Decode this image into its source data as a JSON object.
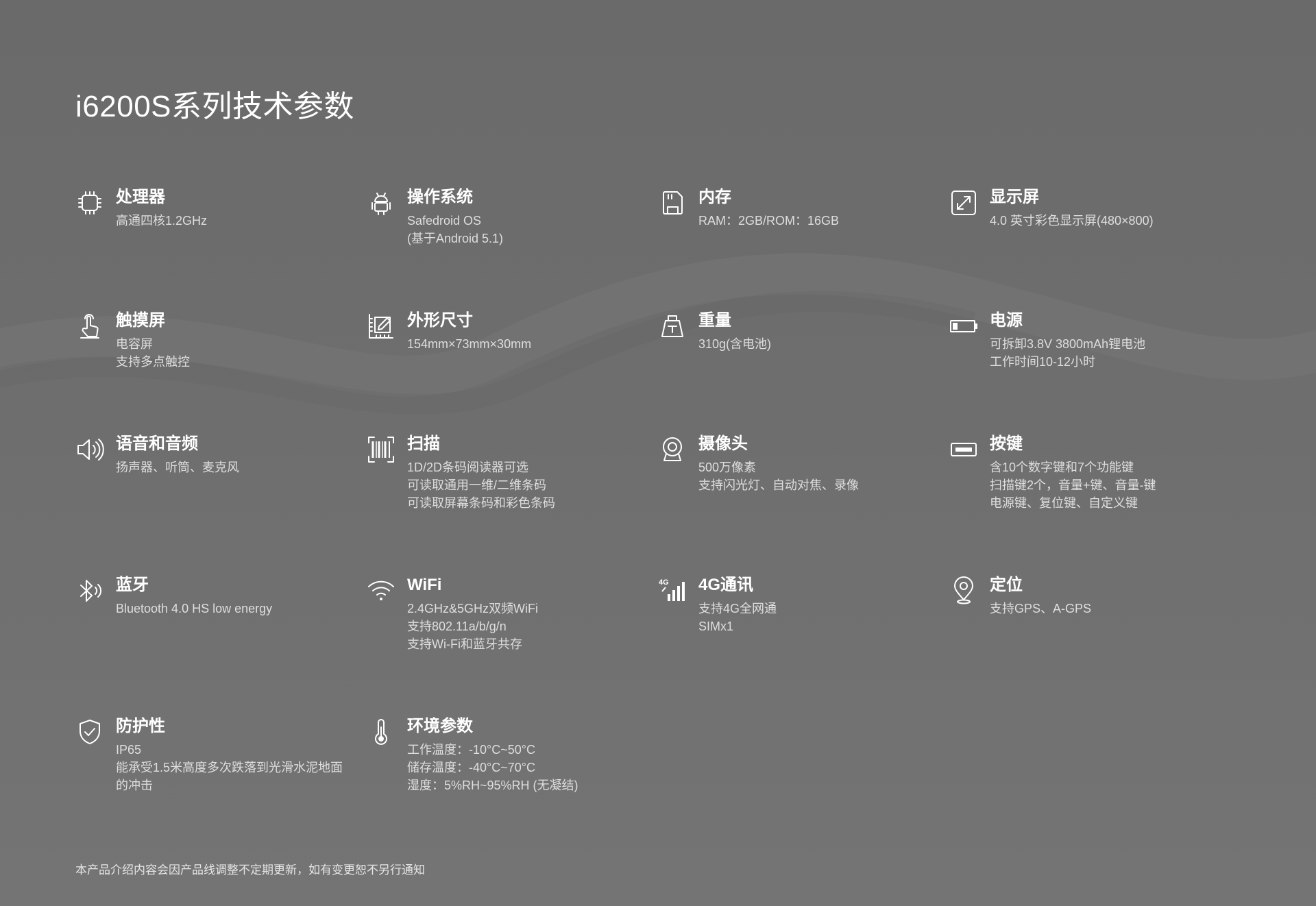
{
  "page": {
    "title": "i6200S系列技术参数",
    "footnote": "本产品介绍内容会因产品线调整不定期更新，如有变更恕不另行通知"
  },
  "colors": {
    "background": "#6e6e6e",
    "text": "#ffffff",
    "subtext": "#dedede"
  },
  "specs": [
    {
      "icon": "cpu-icon",
      "title": "处理器",
      "lines": [
        "高通四核1.2GHz"
      ]
    },
    {
      "icon": "android-icon",
      "title": "操作系统",
      "lines": [
        "Safedroid OS",
        "(基于Android 5.1)"
      ]
    },
    {
      "icon": "sd-card-icon",
      "title": "内存",
      "lines": [
        "RAM：2GB/ROM：16GB"
      ]
    },
    {
      "icon": "expand-icon",
      "title": "显示屏",
      "lines": [
        "4.0 英寸彩色显示屏(480×800)"
      ]
    },
    {
      "icon": "touch-icon",
      "title": "触摸屏",
      "lines": [
        "电容屏",
        "支持多点触控"
      ]
    },
    {
      "icon": "ruler-pencil-icon",
      "title": "外形尺寸",
      "lines": [
        "154mm×73mm×30mm"
      ]
    },
    {
      "icon": "weight-icon",
      "title": "重量",
      "lines": [
        "310g(含电池)"
      ]
    },
    {
      "icon": "battery-icon",
      "title": "电源",
      "lines": [
        "可拆卸3.8V 3800mAh锂电池",
        "工作时间10-12小时"
      ]
    },
    {
      "icon": "speaker-icon",
      "title": "语音和音频",
      "lines": [
        "扬声器、听筒、麦克风"
      ]
    },
    {
      "icon": "barcode-scan-icon",
      "title": "扫描",
      "lines": [
        "1D/2D条码阅读器可选",
        "可读取通用一维/二维条码",
        "可读取屏幕条码和彩色条码"
      ]
    },
    {
      "icon": "webcam-icon",
      "title": "摄像头",
      "lines": [
        "500万像素",
        "支持闪光灯、自动对焦、录像"
      ]
    },
    {
      "icon": "key-icon",
      "title": "按键",
      "lines": [
        "含10个数字键和7个功能键",
        "扫描键2个，音量+键、音量-键",
        "电源键、复位键、自定义键"
      ]
    },
    {
      "icon": "bluetooth-icon",
      "title": "蓝牙",
      "lines": [
        "Bluetooth 4.0 HS low energy"
      ]
    },
    {
      "icon": "wifi-icon",
      "title": "WiFi",
      "lines": [
        "2.4GHz&5GHz双频WiFi",
        "支持802.11a/b/g/n",
        "支持Wi-Fi和蓝牙共存"
      ]
    },
    {
      "icon": "signal-4g-icon",
      "icon_text": "4G",
      "title": "4G通讯",
      "lines": [
        "支持4G全网通",
        "SIMx1"
      ]
    },
    {
      "icon": "location-pin-icon",
      "title": "定位",
      "lines": [
        "支持GPS、A-GPS"
      ]
    },
    {
      "icon": "shield-check-icon",
      "title": "防护性",
      "lines": [
        "IP65",
        "能承受1.5米高度多次跌落到光滑水泥地面",
        "的冲击"
      ]
    },
    {
      "icon": "thermometer-icon",
      "title": "环境参数",
      "lines": [
        "工作温度：-10°C~50°C",
        "储存温度：-40°C~70°C",
        "湿度：5%RH~95%RH (无凝结)"
      ]
    }
  ]
}
